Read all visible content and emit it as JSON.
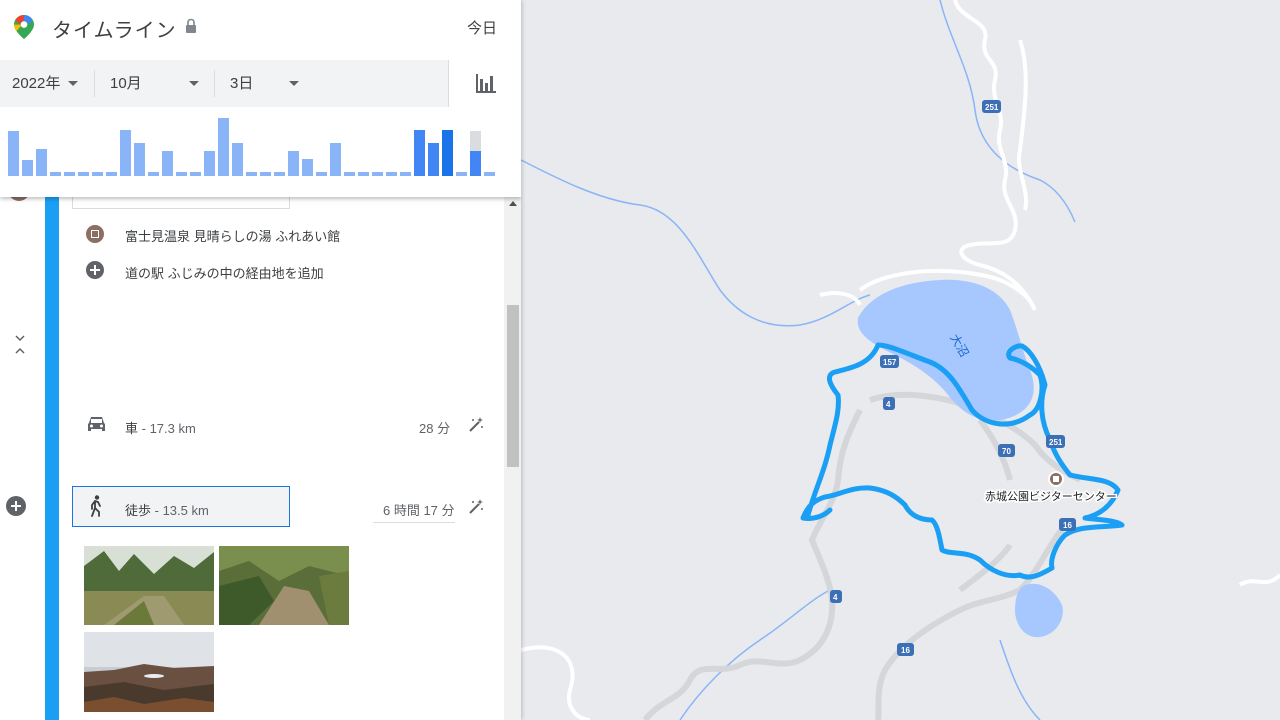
{
  "header": {
    "title": "タイムライン",
    "today": "今日",
    "year": "2022年",
    "month": "10月",
    "day": "3日"
  },
  "day_bars": [
    0.77,
    0.28,
    0.47,
    0.07,
    0.07,
    0.07,
    0.07,
    0.07,
    0.8,
    0.57,
    0.07,
    0.43,
    0.07,
    0.07,
    0.43,
    1.0,
    0.57,
    0.07,
    0.07,
    0.07,
    0.43,
    0.3,
    0.07,
    0.57,
    0.07,
    0.07,
    0.07,
    0.07,
    0.07,
    0.8,
    0.57,
    0.8,
    0.07,
    0.43,
    0.07
  ],
  "timeline": {
    "place1": "富士見温泉 見晴らしの湯 ふれあい館",
    "add_waypoint": "道の駅 ふじみの中の経由地を追加",
    "car_label": "車",
    "car_distance": " - 17.3 km",
    "car_duration": "28 分",
    "walk_label": "徒歩",
    "walk_distance": " - 13.5 km",
    "walk_duration": "6 時間 17 分"
  },
  "map": {
    "lake_label": "大沼",
    "place_label": "赤城公園ビジターセンター",
    "route_badges": [
      "251",
      "251",
      "157",
      "251",
      "70",
      "16",
      "16",
      "4",
      "4"
    ]
  },
  "colors": {
    "route": "#1a9ff5",
    "lake": "#a6c8ff",
    "place_marker": "#8d6e63"
  }
}
